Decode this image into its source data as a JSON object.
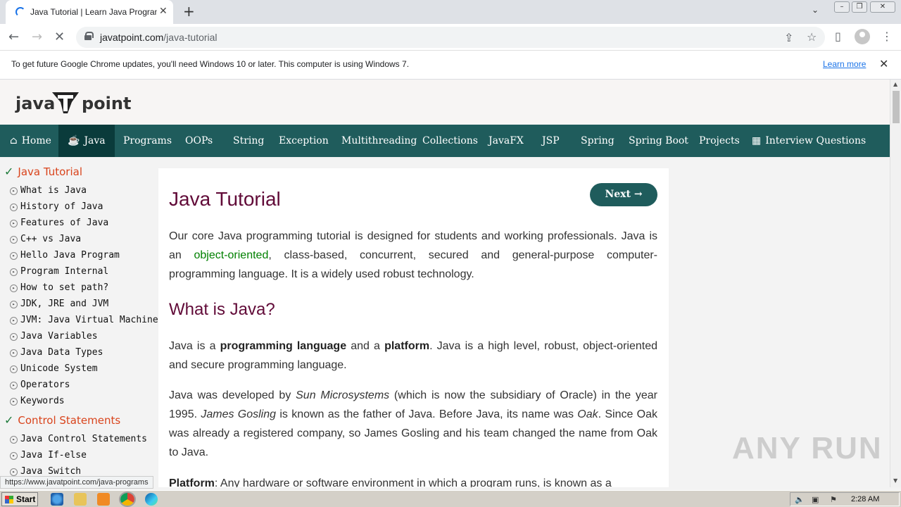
{
  "browser": {
    "tab_title": "Java Tutorial | Learn Java Programming",
    "url_host": "javatpoint.com",
    "url_path": "/java-tutorial",
    "status_url": "https://www.javatpoint.com/java-programs"
  },
  "infobar": {
    "message": "To get future Google Chrome updates, you'll need Windows 10 or later. This computer is using Windows 7.",
    "link": "Learn more"
  },
  "site": {
    "logo_left": "java",
    "logo_right": "point",
    "nav": [
      "Home",
      "Java",
      "Programs",
      "OOPs",
      "String",
      "Exception",
      "Multithreading",
      "Collections",
      "JavaFX",
      "JSP",
      "Spring",
      "Spring Boot",
      "Projects",
      "Interview Questions"
    ]
  },
  "sidebar": {
    "section1": "Java Tutorial",
    "items1": [
      "What is Java",
      "History of Java",
      "Features of Java",
      "C++ vs Java",
      "Hello Java Program",
      "Program Internal",
      "How to set path?",
      "JDK, JRE and JVM",
      "JVM: Java Virtual Machine",
      "Java Variables",
      "Java Data Types",
      "Unicode System",
      "Operators",
      "Keywords"
    ],
    "section2": "Control Statements",
    "items2": [
      "Java Control Statements",
      "Java If-else",
      "Java Switch"
    ]
  },
  "content": {
    "title": "Java Tutorial",
    "next_label": "Next →",
    "p1_a": "Our core Java programming tutorial is designed for students and working professionals. Java is an ",
    "p1_link": "object-oriented",
    "p1_b": ", class-based, concurrent, secured and general-purpose computer-programming language. It is a widely used robust technology.",
    "h2": "What is Java?",
    "p2_a": "Java is a ",
    "p2_b1": "programming language",
    "p2_c": " and a ",
    "p2_b2": "platform",
    "p2_d": ". Java is a high level, robust, object-oriented and secure programming language.",
    "p3_a": "Java was developed by ",
    "p3_i1": "Sun Microsystems",
    "p3_b": " (which is now the subsidiary of Oracle) in the year 1995. ",
    "p3_i2": "James Gosling",
    "p3_c": " is known as the father of Java. Before Java, its name was ",
    "p3_i3": "Oak",
    "p3_d": ". Since Oak was already a registered company, so James Gosling and his team changed the name from Oak to Java.",
    "p4_b": "Platform",
    "p4_a": ": Any hardware or software environment in which a program runs, is known as a"
  },
  "watermark": "ANY RUN",
  "taskbar": {
    "start": "Start",
    "clock": "2:28 AM"
  }
}
